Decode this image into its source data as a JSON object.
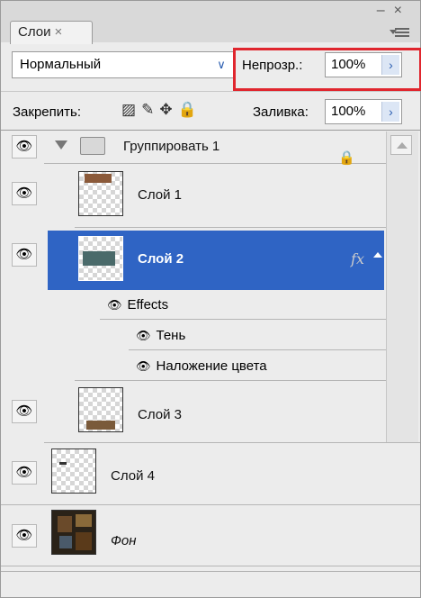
{
  "window": {
    "minimize": "–",
    "close": "×"
  },
  "tab": {
    "label": "Слои",
    "close": "×"
  },
  "blend": {
    "mode": "Нормальный",
    "arrow": "∨"
  },
  "opacity": {
    "label": "Непрозр.:",
    "value": "100%",
    "arrow": "›"
  },
  "lock": {
    "label": "Закрепить:",
    "icons": [
      "lock-transparent-icon",
      "lock-brush-icon",
      "lock-move-icon",
      "lock-all-icon"
    ]
  },
  "fill": {
    "label": "Заливка:",
    "value": "100%",
    "arrow": "›"
  },
  "layers": {
    "group": {
      "name": "Группировать 1"
    },
    "layer1": {
      "name": "Слой 1"
    },
    "layer2": {
      "name": "Слой 2",
      "fx": "fx"
    },
    "effects": {
      "label": "Effects"
    },
    "shadow": {
      "label": "Тень"
    },
    "color_overlay": {
      "label": "Наложение цвета"
    },
    "layer3": {
      "name": "Слой 3"
    },
    "layer4": {
      "name": "Слой 4"
    },
    "background": {
      "name": "Фон"
    }
  },
  "colors": {
    "selection": "#2f64c4",
    "highlight": "#e0262e",
    "accent": "#2a5db0"
  }
}
